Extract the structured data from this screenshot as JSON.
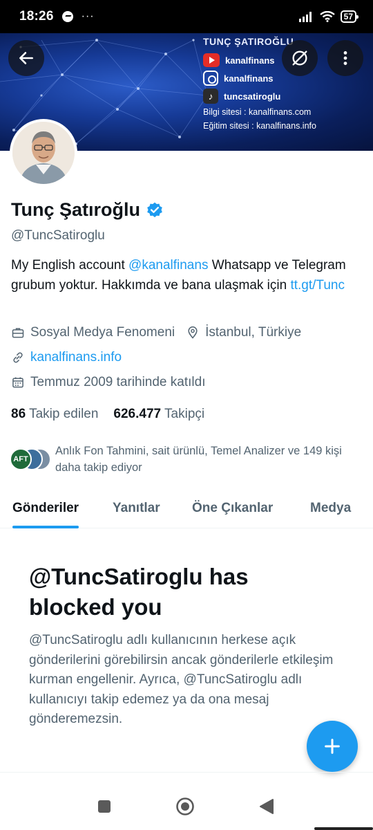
{
  "status_bar": {
    "time": "18:26",
    "dots": "···",
    "battery": "57"
  },
  "banner": {
    "title": "TUNÇ ŞATIROĞLU",
    "socials": [
      {
        "icon": "youtube-icon",
        "label": "kanalfinans"
      },
      {
        "icon": "instagram-icon",
        "label": "kanalfinans"
      },
      {
        "icon": "tiktok-icon",
        "label": "tuncsatiroglu"
      }
    ],
    "info_site": "Bilgi sitesi : kanalfinans.com",
    "edu_site": "Eğitim sitesi : kanalfinans.info"
  },
  "profile": {
    "name": "Tunç Şatıroğlu",
    "handle": "@TuncSatiroglu",
    "bio": {
      "part1": "My English account ",
      "mention": "@kanalfinans",
      "part2": " Whatsapp ve Telegram grubum yoktur. Hakkımda ve bana ulaşmak için ",
      "link": "tt.gt/Tunc"
    },
    "category": "Sosyal Medya Fenomeni",
    "location": "İstanbul, Türkiye",
    "website": "kanalfinans.info",
    "joined": "Temmuz 2009 tarihinde katıldı",
    "following_count": "86",
    "following_label": "Takip edilen",
    "followers_count": "626.477",
    "followers_label": "Takipçi",
    "followed_by": "Anlık Fon Tahmini, sait ürünlü, Temel Analizer ve 149 kişi daha takip ediyor",
    "mini_avatar_text": "AFT"
  },
  "tabs": [
    {
      "label": "Gönderiler",
      "active": true
    },
    {
      "label": "Yanıtlar",
      "active": false
    },
    {
      "label": "Öne Çıkanlar",
      "active": false
    },
    {
      "label": "Medya",
      "active": false
    }
  ],
  "blocked": {
    "title": "@TuncSatiroglu has blocked you",
    "body": "@TuncSatiroglu adlı kullanıcının herkese açık gönderilerini görebilirsin ancak gönderilerle etkileşim kurman engellenir. Ayrıca, @TuncSatiroglu adlı kullanıcıyı takip edemez ya da ona mesaj gönderemezsin."
  },
  "colors": {
    "accent": "#1d9bf0",
    "text": "#0f1419",
    "secondary": "#536471"
  }
}
